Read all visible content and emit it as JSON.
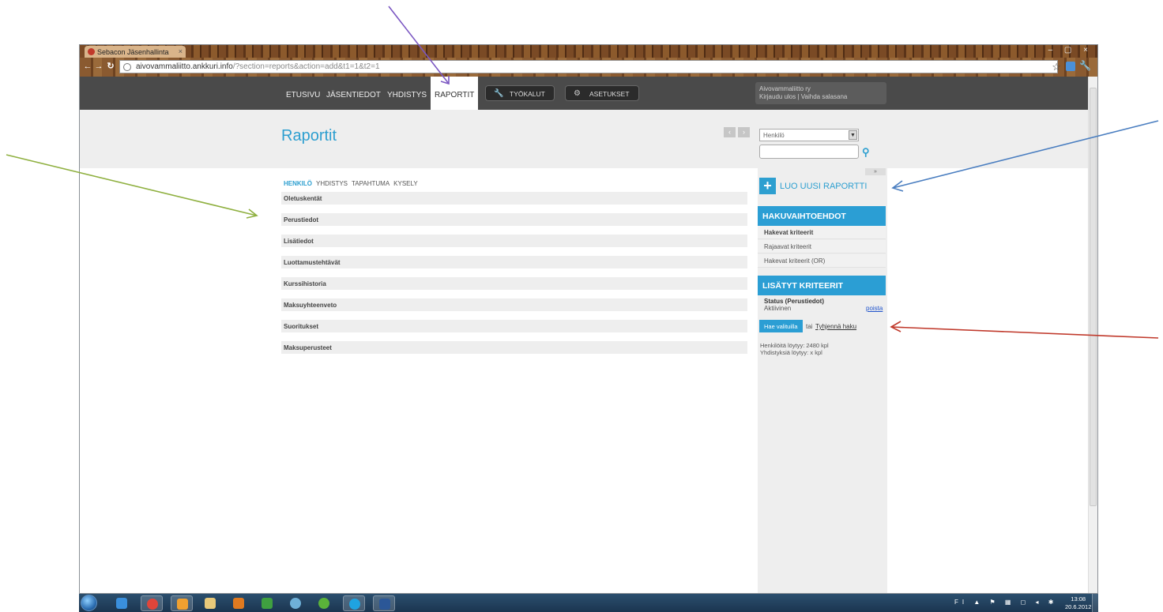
{
  "browser": {
    "tab_title": "Sebacon Jäsenhallinta",
    "tab_close": "×",
    "window_controls": "– ▢ ×",
    "url_host": "aivovammaliitto.ankkuri.info",
    "url_path": "/?section=reports&action=add&t1=1&t2=1"
  },
  "nav": {
    "items": [
      "ETUSIVU",
      "JÄSENTIEDOT",
      "YHDISTYS",
      "RAPORTIT"
    ],
    "active": "RAPORTIT",
    "tools_label": "TYÖKALUT",
    "settings_label": "ASETUKSET",
    "user_org": "Aivovammaliitto ry",
    "user_links": "Kirjaudu ulos | Vaihda salasana"
  },
  "header": {
    "title": "Raportit",
    "pager_prev": "‹",
    "pager_next": "›",
    "search_select_value": "Henkilö",
    "search_input_value": ""
  },
  "main": {
    "tabs": [
      "HENKILÖ",
      "YHDISTYS",
      "TAPAHTUMA",
      "KYSELY"
    ],
    "active_tab": "HENKILÖ",
    "sections": [
      "Oletuskentät",
      "Perustiedot",
      "Lisätiedot",
      "Luottamustehtävät",
      "Kurssihistoria",
      "Maksuyhteenveto",
      "Suoritukset",
      "Maksuperusteet"
    ]
  },
  "sidebar": {
    "collapse": "»",
    "new_report": "LUO UUSI RAPORTTI",
    "options_heading": "HAKUVAIHTOEHDOT",
    "options": [
      "Hakevat kriteerit",
      "Rajaavat kriteerit",
      "Hakevat kriteerit (OR)"
    ],
    "criteria_heading": "LISÄTYT KRITEERIT",
    "criterion_title": "Status (Perustiedot)",
    "criterion_value": "Aktiivinen",
    "remove_label": "poista",
    "search_button": "Hae valituilla",
    "or_text": "tai",
    "clear_link": "Tyhjennä haku",
    "count_persons": "Henkilöitä löytyy: 2480 kpl",
    "count_associations": "Yhdistyksiä löytyy: x kpl"
  },
  "taskbar": {
    "tray_lang": "FI",
    "clock_time": "13:08",
    "clock_date": "20.6.2012"
  },
  "colors": {
    "accent": "#2d9fd0",
    "nav_bg": "#4a4a4a",
    "arrow_purple": "#7b57c2",
    "arrow_green": "#8fb040",
    "arrow_blue": "#4a7ec0",
    "arrow_red": "#c0392b"
  }
}
